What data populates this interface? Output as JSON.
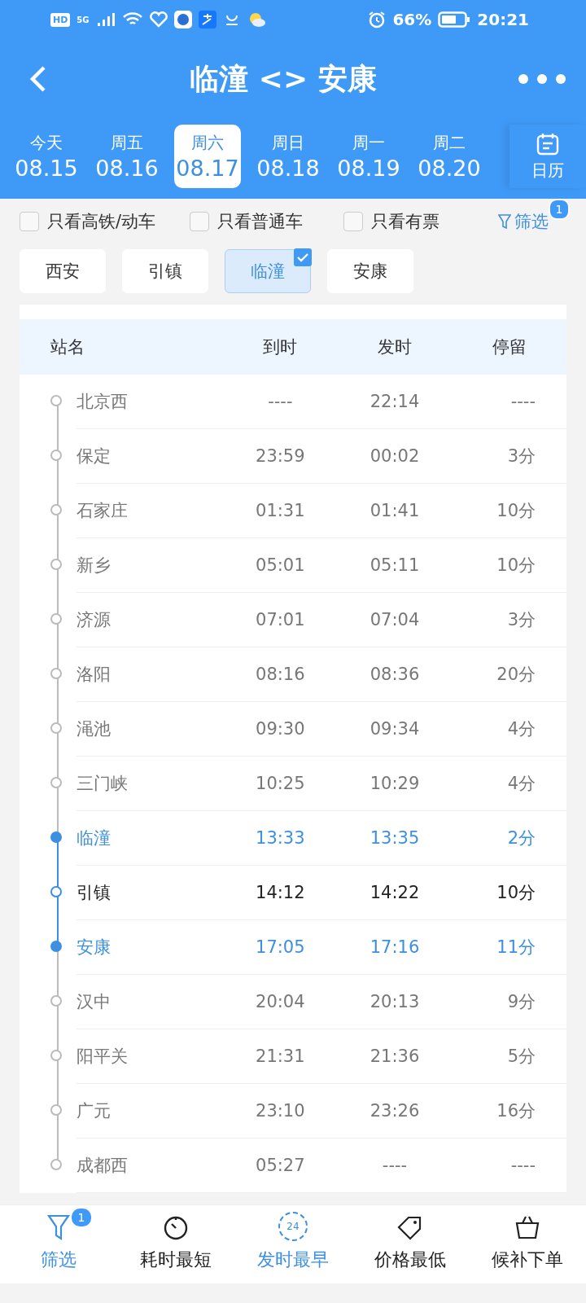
{
  "status_bar": {
    "network_badges": [
      "HD",
      "5G"
    ],
    "battery": "66%",
    "time": "20:21"
  },
  "header": {
    "title": "临潼 <> 安康"
  },
  "dates": [
    {
      "weekday": "今天",
      "date": "08.15",
      "selected": false
    },
    {
      "weekday": "周五",
      "date": "08.16",
      "selected": false
    },
    {
      "weekday": "周六",
      "date": "08.17",
      "selected": true
    },
    {
      "weekday": "周日",
      "date": "08.18",
      "selected": false
    },
    {
      "weekday": "周一",
      "date": "08.19",
      "selected": false
    },
    {
      "weekday": "周二",
      "date": "08.20",
      "selected": false
    }
  ],
  "calendar_button": "日历",
  "filters": [
    {
      "label": "只看高铁/动车",
      "checked": false
    },
    {
      "label": "只看普通车",
      "checked": false
    },
    {
      "label": "只看有票",
      "checked": false
    }
  ],
  "filter_link": {
    "label": "筛选",
    "badge": "1"
  },
  "station_chips": [
    {
      "label": "西安",
      "selected": false
    },
    {
      "label": "引镇",
      "selected": false
    },
    {
      "label": "临潼",
      "selected": true
    },
    {
      "label": "安康",
      "selected": false
    }
  ],
  "table": {
    "columns": [
      "站名",
      "到时",
      "发时",
      "停留"
    ],
    "rows": [
      {
        "kind": "other",
        "station": "北京西",
        "arrive": "----",
        "depart": "22:14",
        "stay": "----"
      },
      {
        "kind": "other",
        "station": "保定",
        "arrive": "23:59",
        "depart": "00:02",
        "stay": "3分"
      },
      {
        "kind": "other",
        "station": "石家庄",
        "arrive": "01:31",
        "depart": "01:41",
        "stay": "10分"
      },
      {
        "kind": "other",
        "station": "新乡",
        "arrive": "05:01",
        "depart": "05:11",
        "stay": "10分"
      },
      {
        "kind": "other",
        "station": "济源",
        "arrive": "07:01",
        "depart": "07:04",
        "stay": "3分"
      },
      {
        "kind": "other",
        "station": "洛阳",
        "arrive": "08:16",
        "depart": "08:36",
        "stay": "20分"
      },
      {
        "kind": "other",
        "station": "渑池",
        "arrive": "09:30",
        "depart": "09:34",
        "stay": "4分"
      },
      {
        "kind": "other",
        "station": "三门峡",
        "arrive": "10:25",
        "depart": "10:29",
        "stay": "4分"
      },
      {
        "kind": "endpoint",
        "station": "临潼",
        "arrive": "13:33",
        "depart": "13:35",
        "stay": "2分"
      },
      {
        "kind": "onroute",
        "station": "引镇",
        "arrive": "14:12",
        "depart": "14:22",
        "stay": "10分"
      },
      {
        "kind": "endpoint",
        "station": "安康",
        "arrive": "17:05",
        "depart": "17:16",
        "stay": "11分"
      },
      {
        "kind": "other",
        "station": "汉中",
        "arrive": "20:04",
        "depart": "20:13",
        "stay": "9分"
      },
      {
        "kind": "other",
        "station": "阳平关",
        "arrive": "21:31",
        "depart": "21:36",
        "stay": "5分"
      },
      {
        "kind": "other",
        "station": "广元",
        "arrive": "23:10",
        "depart": "23:26",
        "stay": "16分"
      },
      {
        "kind": "other",
        "station": "成都西",
        "arrive": "05:27",
        "depart": "----",
        "stay": "----"
      }
    ]
  },
  "bottom_nav": [
    {
      "kind": "funnel",
      "label": "筛选",
      "selected": true,
      "badge": "1"
    },
    {
      "kind": "timer",
      "label": "耗时最短",
      "selected": false
    },
    {
      "kind": "clock24",
      "icon_text": "24",
      "label": "发时最早",
      "selected": true
    },
    {
      "kind": "tag",
      "label": "价格最低",
      "selected": false
    },
    {
      "kind": "basket",
      "label": "候补下单",
      "selected": false
    }
  ]
}
